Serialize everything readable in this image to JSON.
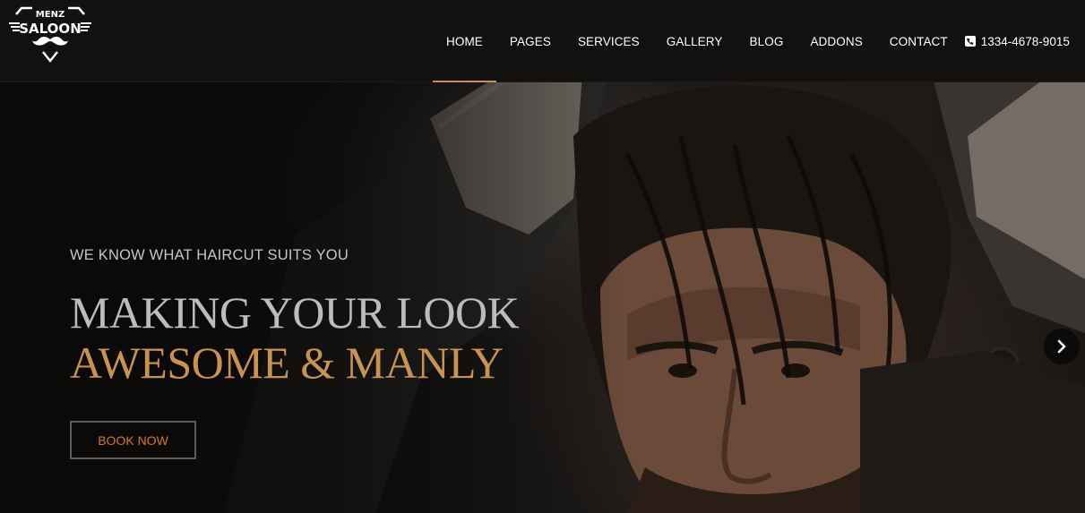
{
  "logo": {
    "top_text": "MENZ",
    "main_text": "SALOON"
  },
  "nav": {
    "items": [
      {
        "label": "HOME",
        "active": true
      },
      {
        "label": "PAGES",
        "active": false
      },
      {
        "label": "SERVICES",
        "active": false
      },
      {
        "label": "GALLERY",
        "active": false
      },
      {
        "label": "BLOG",
        "active": false
      },
      {
        "label": "ADDONS",
        "active": false
      },
      {
        "label": "CONTACT",
        "active": false
      }
    ],
    "phone": "1334-4678-9015"
  },
  "hero": {
    "tagline": "WE KNOW WHAT HAIRCUT SUITS YOU",
    "headline_line1": "MAKING YOUR LOOK",
    "headline_line2": "AWESOME & MANLY",
    "cta_label": "BOOK NOW"
  },
  "colors": {
    "accent_gold": "#c7934f",
    "cta_text": "#d3771c",
    "header_bg": "#121110"
  },
  "icons": {
    "phone": "phone-icon",
    "next": "chevron-right-icon",
    "logo_mark": "mustache-icon"
  }
}
